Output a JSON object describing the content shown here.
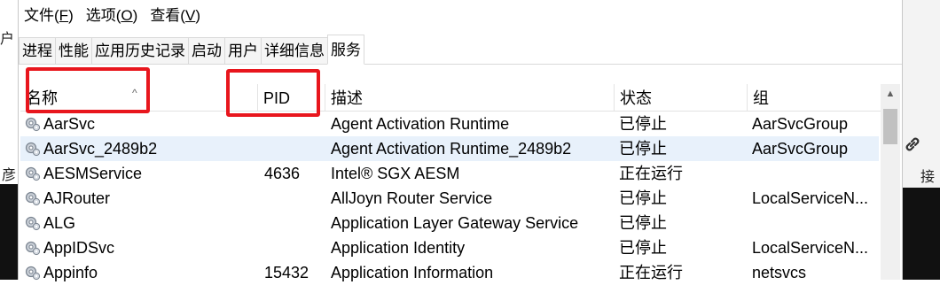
{
  "menu": {
    "file": {
      "label": "文件(",
      "key": "F",
      "end": ")"
    },
    "options": {
      "label": "选项(",
      "key": "O",
      "end": ")"
    },
    "view": {
      "label": "查看(",
      "key": "V",
      "end": ")"
    }
  },
  "tabs": [
    "进程",
    "性能",
    "应用历史记录",
    "启动",
    "用户",
    "详细信息",
    "服务"
  ],
  "active_tab": "服务",
  "columns": {
    "name": "名称",
    "pid": "PID",
    "desc": "描述",
    "state": "状态",
    "group": "组"
  },
  "rows": [
    {
      "name": "AarSvc",
      "pid": "",
      "desc": "Agent Activation Runtime",
      "state": "已停止",
      "group": "AarSvcGroup"
    },
    {
      "name": "AarSvc_2489b2",
      "pid": "",
      "desc": "Agent Activation Runtime_2489b2",
      "state": "已停止",
      "group": "AarSvcGroup"
    },
    {
      "name": "AESMService",
      "pid": "4636",
      "desc": "Intel® SGX AESM",
      "state": "正在运行",
      "group": ""
    },
    {
      "name": "AJRouter",
      "pid": "",
      "desc": "AllJoyn Router Service",
      "state": "已停止",
      "group": "LocalServiceN..."
    },
    {
      "name": "ALG",
      "pid": "",
      "desc": "Application Layer Gateway Service",
      "state": "已停止",
      "group": ""
    },
    {
      "name": "AppIDSvc",
      "pid": "",
      "desc": "Application Identity",
      "state": "已停止",
      "group": "LocalServiceN..."
    },
    {
      "name": "Appinfo",
      "pid": "15432",
      "desc": "Application Information",
      "state": "正在运行",
      "group": "netsvcs"
    }
  ],
  "background": {
    "frag1": "户",
    "frag2": "彦",
    "frag3": "接"
  },
  "colors": {
    "highlight": "#e8161d",
    "selected_row": "#e8f1fb"
  },
  "icons": {
    "service": "gear-icon",
    "background_link": "link-icon"
  }
}
